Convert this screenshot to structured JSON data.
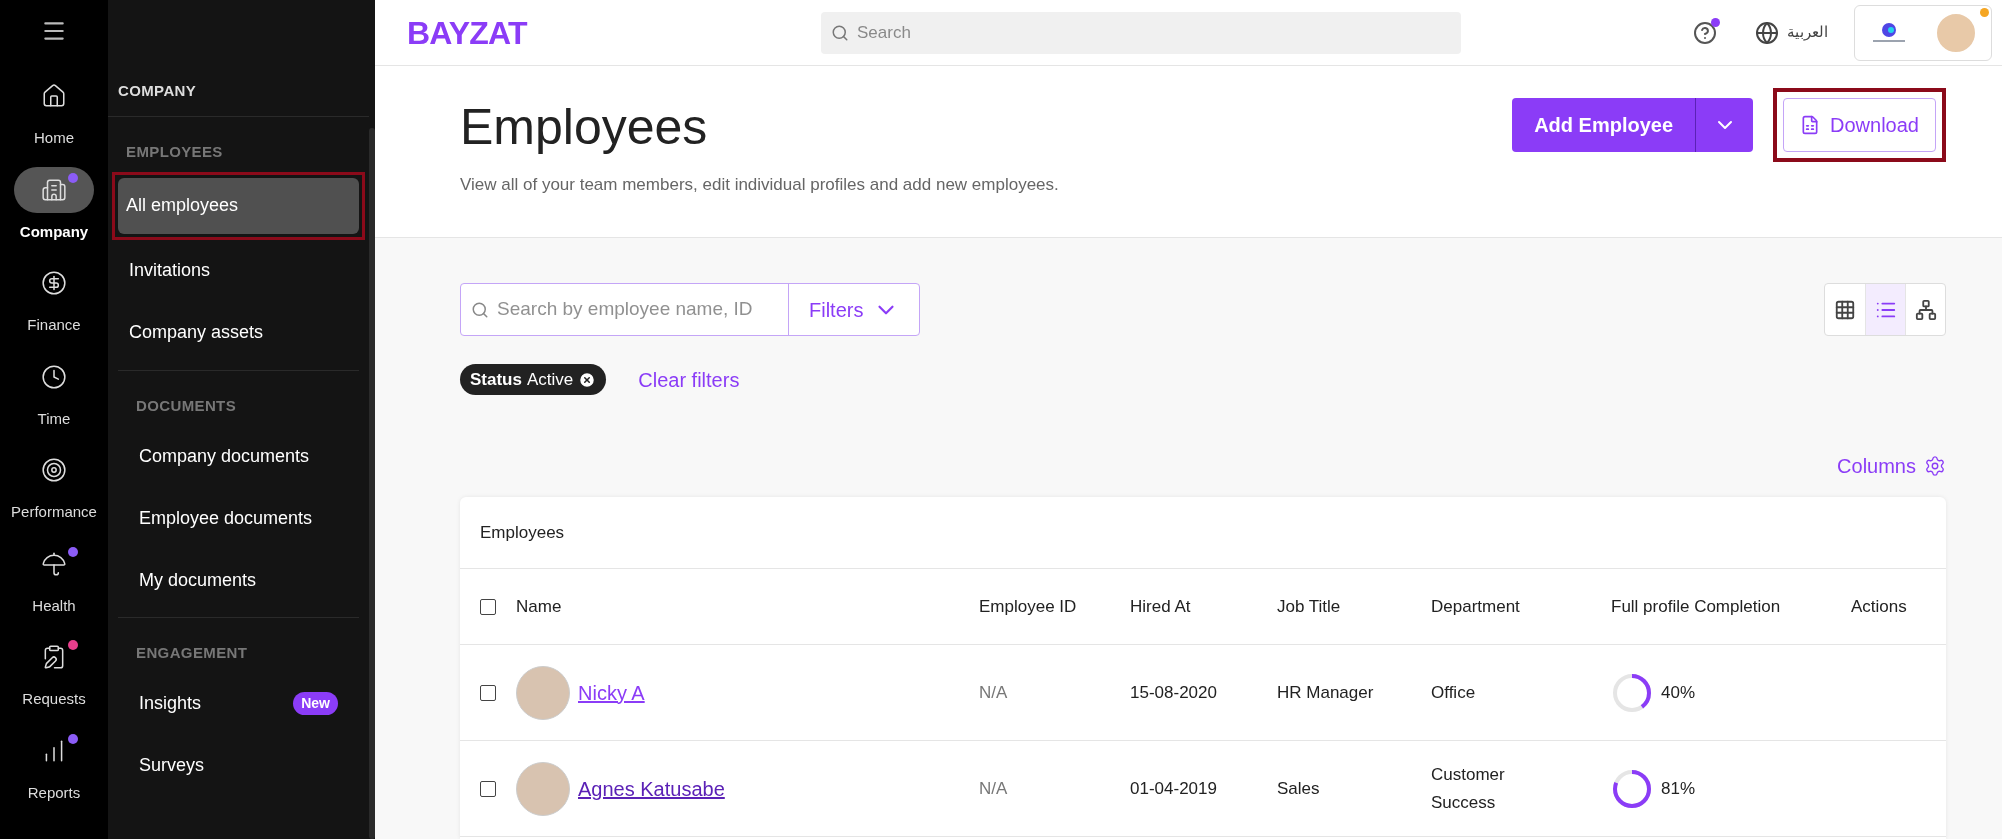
{
  "rail": {
    "items": [
      {
        "label": "Home",
        "selected": false
      },
      {
        "label": "Company",
        "selected": true,
        "color": "#8b5cf6"
      },
      {
        "label": "Finance",
        "selected": false
      },
      {
        "label": "Time",
        "selected": false
      },
      {
        "label": "Performance",
        "selected": false
      },
      {
        "label": "Health",
        "selected": false,
        "color": "#8b5cf6"
      },
      {
        "label": "Requests",
        "selected": false,
        "color": "#e83e8c"
      },
      {
        "label": "Reports",
        "selected": false,
        "color": "#8b5cf6"
      }
    ]
  },
  "sidebar": {
    "title": "COMPANY",
    "sections": [
      {
        "heading": "EMPLOYEES",
        "items": [
          {
            "label": "All employees",
            "selected": true,
            "highlighted": true
          },
          {
            "label": "Invitations",
            "selected": false,
            "highlighted": false
          },
          {
            "label": "Company assets",
            "selected": false,
            "highlighted": false
          }
        ]
      },
      {
        "heading": "DOCUMENTS",
        "items": [
          {
            "label": "Company documents",
            "selected": false,
            "highlighted": false
          },
          {
            "label": "Employee documents",
            "selected": false,
            "highlighted": false
          },
          {
            "label": "My documents",
            "selected": false,
            "highlighted": false
          }
        ]
      },
      {
        "heading": "ENGAGEMENT",
        "items": [
          {
            "label": "Insights",
            "selected": false,
            "highlighted": false,
            "badge": "New"
          },
          {
            "label": "Surveys",
            "selected": false,
            "highlighted": false
          }
        ]
      }
    ]
  },
  "topbar": {
    "logo": "BAYZAT",
    "search": {
      "placeholder": "Search"
    },
    "help_notification": true,
    "language": "العربية",
    "profile_notification": true
  },
  "header": {
    "title": "Employees",
    "subtitle": "View all of your team members, edit individual profiles and add new employees.",
    "add_button": "Add Employee",
    "download_button": {
      "label": "Download",
      "highlighted": true
    }
  },
  "toolbar": {
    "search": {
      "placeholder": "Search by employee name, ID"
    },
    "filters_button": "Filters",
    "views": [
      {
        "kind": "grid",
        "selected": false
      },
      {
        "kind": "list",
        "selected": true
      },
      {
        "kind": "org",
        "selected": false
      }
    ]
  },
  "filter_chips": [
    {
      "label": "Status",
      "value": "Active"
    }
  ],
  "clear_filters": "Clear filters",
  "columns_button": "Columns",
  "table": {
    "title": "Employees",
    "all_checked": false,
    "columns": [
      "Name",
      "Employee ID",
      "Hired At",
      "Job Title",
      "Department",
      "Full profile Completion",
      "Actions"
    ],
    "rows": [
      {
        "checked": false,
        "name": "Nicky A",
        "visited": false,
        "employee_id": "N/A",
        "hired_at": "15-08-2020",
        "job_title": "HR Manager",
        "department": "Office",
        "completion": "40%",
        "level": 0.4
      },
      {
        "checked": false,
        "name": "Agnes Katusabe",
        "visited": true,
        "employee_id": "N/A",
        "hired_at": "01-04-2019",
        "job_title": "Sales",
        "department": "Customer Success",
        "completion": "81%",
        "level": 0.81
      }
    ]
  }
}
